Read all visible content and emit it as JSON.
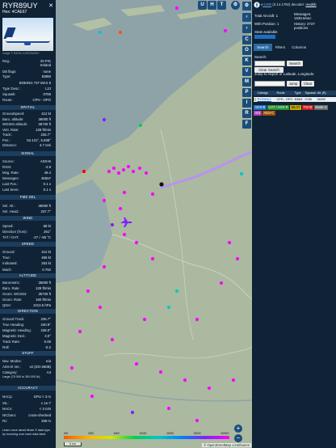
{
  "aircraft": {
    "callsign": "RYR89UY",
    "hex_label": "Hex:",
    "hex": "4CAE67",
    "close_glyph": "✕",
    "image_caption": "Image © RAFAL KURZAWSKI",
    "reg_label": "Reg.:",
    "reg": "EI-FIG",
    "country": "Ireland",
    "db_flags_label": "DB flags:",
    "db_flags": "none",
    "type_label": "Type:",
    "type": "B38M",
    "type_full": "BOEING 737 MAX 8",
    "type_desc_label": "Type Desc.:",
    "type_desc": "L2J",
    "squawk_label": "Squawk:",
    "squawk": "0766",
    "route_label": "Route:",
    "route": "CPH - OPO"
  },
  "sections": {
    "spatial": "SPATIAL",
    "signal": "SIGNAL",
    "fms": "FMS SEL",
    "wind": "WIND",
    "speed": "SPEED",
    "altitude": "ALTITUDE",
    "direction": "DIRECTION",
    "stuff": "STUFF",
    "accuracy": "ACCURACY"
  },
  "spatial": [
    {
      "k": "Groundspeed:",
      "v": "412 kt"
    },
    {
      "k": "Baro. altitude:",
      "v": "36000 ft"
    },
    {
      "k": "WGS84 altitude:",
      "v": "35725 ft"
    },
    {
      "k": "Vert. Rate:",
      "v": "128 ft/min"
    },
    {
      "k": "Track:",
      "v": "235.7°"
    },
    {
      "k": "Pos.:",
      "v": "53.121°, 5.838°"
    },
    {
      "k": "Distance:",
      "v": "4.7 nmi"
    }
  ],
  "signal": [
    {
      "k": "Source:",
      "v": "ADS-B"
    },
    {
      "k": "RSSI:",
      "v": "-4.9"
    },
    {
      "k": "Msg. Rate:",
      "v": "49.4"
    },
    {
      "k": "Messages:",
      "v": "36557"
    },
    {
      "k": "Last Pos.:",
      "v": "0.1 s"
    },
    {
      "k": "Last Seen:",
      "v": "0.1 s"
    }
  ],
  "fms": [
    {
      "k": "Sel. Alt.:",
      "v": "36000 ft"
    },
    {
      "k": "Sel. Head.:",
      "v": "237.7°"
    }
  ],
  "wind": [
    {
      "k": "Speed:",
      "v": "58 kt"
    },
    {
      "k": "Direction (from):",
      "v": "261°"
    },
    {
      "k": "TAT / OAT:",
      "v": "-27 / -55 °C"
    }
  ],
  "speed": [
    {
      "k": "Ground:",
      "v": "412 kt"
    },
    {
      "k": "True:",
      "v": "456 kt"
    },
    {
      "k": "Indicated:",
      "v": "263 kt"
    },
    {
      "k": "Mach:",
      "v": "0.792"
    }
  ],
  "altitude": [
    {
      "k": "Barometric:",
      "v": "36000 ft"
    },
    {
      "k": "Baro. Rate:",
      "v": "128 ft/min"
    },
    {
      "k": "Geom. WGS84:",
      "v": "35725 ft"
    },
    {
      "k": "Geom. Rate:",
      "v": "160 ft/min"
    },
    {
      "k": "QNH:",
      "v": "1013.6 hPa"
    }
  ],
  "direction": [
    {
      "k": "Ground Track:",
      "v": "235.7°"
    },
    {
      "k": "True Heading:",
      "v": "240.9°"
    },
    {
      "k": "Magnetic Heading:",
      "v": "238.0°"
    },
    {
      "k": "Magnetic Decl.:",
      "v": "3.0°"
    },
    {
      "k": "Track Rate:",
      "v": "0.00"
    },
    {
      "k": "Roll:",
      "v": "-0.2"
    }
  ],
  "stuff": [
    {
      "k": "Nav. Modes:",
      "v": "n/a"
    },
    {
      "k": "ADS-B Ver.:",
      "v": "v2 (DO-260B)"
    },
    {
      "k": "Category:",
      "v": "A3"
    }
  ],
  "stuff_note": "Large (75 000 to 300 000 lb)",
  "accuracy": [
    {
      "k": "NACp:",
      "v": "EPU < 3 m"
    },
    {
      "k": "SIL:",
      "v": "≤ 1e-7"
    },
    {
      "k": "NACv:",
      "v": "< 3 m/s"
    },
    {
      "k": "NICbaro:",
      "v": "cross-checked"
    },
    {
      "k": "Rc:",
      "v": "186 m"
    }
  ],
  "learn_more": "Learn more about Mode S data type by hovering over each data label.",
  "map": {
    "top_buttons": [
      "U",
      "H",
      "T"
    ],
    "zoom_in": "+",
    "zoom_out": "−",
    "attribution": "© OpenStreetMap contributors",
    "scale_label": "5 nm",
    "legend_ticks": [
      "500",
      "2000",
      "6000",
      "10000",
      "20000",
      "30000",
      "40000+"
    ]
  },
  "toolbar": [
    "C",
    "O",
    "K",
    "V",
    "M",
    "P",
    "I",
    "R",
    "F"
  ],
  "sidebar": {
    "version_prefix": "v",
    "version_link": "r1090",
    "version_rest": " (3.14.1792) decoder: ",
    "decoder_link": "readsb",
    "total_label": "Total Aircraft: 1",
    "with_pos_label": "With Position: 1",
    "messages_label": "Messages:",
    "messages_value": "1635.6/sec",
    "history_label": "History: 2727",
    "history_value": "positions",
    "stats_label": "Stats available",
    "tabs": [
      "Search",
      "Filters",
      "Columns"
    ],
    "search_label": "Search:",
    "search_button": "Search",
    "clear_search": "Clear Search",
    "jump_label": "Jump to Airport or Latitude, Longitude:",
    "jump_button": "Jump",
    "clear_button": "Clear",
    "table_headers": [
      "",
      "Callsign",
      "Route",
      "Type",
      "Squawk",
      "Alt. (ft)"
    ],
    "table_row": [
      "",
      "RYR89UY",
      "CPH - OPO",
      "B38M",
      "0766",
      "36000"
    ],
    "sources": [
      {
        "label": "ADS-B",
        "bg": "#1e6fbf",
        "fg": "#ffffff"
      },
      {
        "label": "UAT / ADS-R",
        "bg": "#2a8f2a",
        "fg": "#ffffff"
      },
      {
        "label": "MLAT",
        "bg": "#c8a800",
        "fg": "#111111"
      },
      {
        "label": "TIS-B",
        "bg": "#d02020",
        "fg": "#ffffff"
      },
      {
        "label": "Mode-S",
        "bg": "#6a6a6a",
        "fg": "#ffffff"
      },
      {
        "label": "AIS",
        "bg": "#b040b0",
        "fg": "#ffffff"
      },
      {
        "label": "ADS-C",
        "bg": "#a04a00",
        "fg": "#ffffff"
      }
    ]
  },
  "colors": {
    "panel_bg": "#0f2236",
    "accent": "#1b4d7a",
    "map_land": "#a8b8a0",
    "map_water": "#7f9aa6",
    "aircraft_marker": "#ff00ff",
    "track_line": "#b98cff"
  }
}
